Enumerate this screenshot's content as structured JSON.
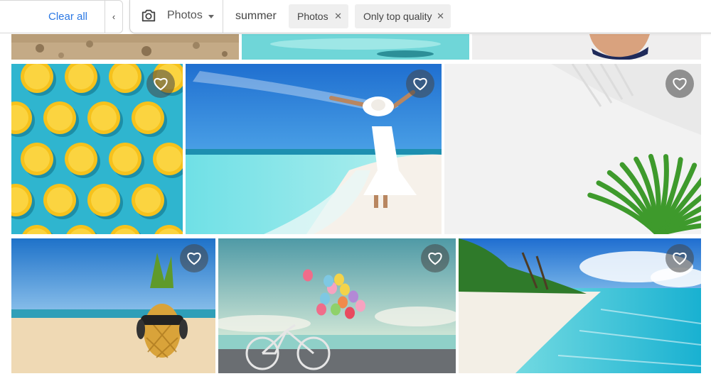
{
  "filters": {
    "clear_all_label": "Clear all",
    "collapse_icon": "chevron-left-icon"
  },
  "search": {
    "type_icon": "camera-icon",
    "type_label": "Photos",
    "query": "summer",
    "chips": [
      {
        "label": "Photos",
        "remove_icon": "close-icon"
      },
      {
        "label": "Only top quality",
        "remove_icon": "close-icon"
      }
    ]
  },
  "gallery": {
    "favorite_icon": "heart-outline-icon",
    "images": [
      {
        "subject": "sand"
      },
      {
        "subject": "turquoise water"
      },
      {
        "subject": "woman in bikini"
      },
      {
        "subject": "lemon slices on blue"
      },
      {
        "subject": "woman in white dress on beach"
      },
      {
        "subject": "palm leaf on white"
      },
      {
        "subject": "pineapple with sunglasses on beach"
      },
      {
        "subject": "bicycle with balloons"
      },
      {
        "subject": "tropical beach with palms"
      }
    ]
  },
  "colors": {
    "link": "#2b78e4",
    "chip_bg": "#efefef",
    "heart_bg": "#464646"
  }
}
